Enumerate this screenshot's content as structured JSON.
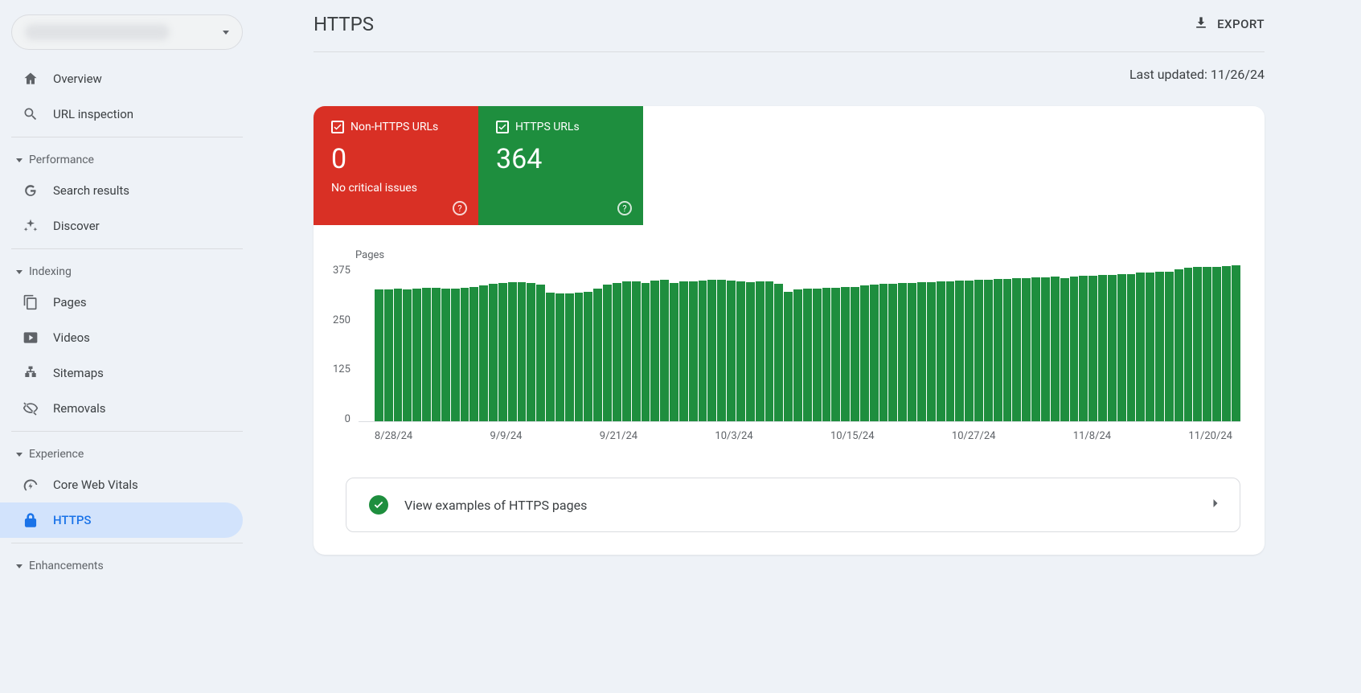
{
  "sidebar": {
    "items": {
      "overview": "Overview",
      "url_inspection": "URL inspection",
      "search_results": "Search results",
      "discover": "Discover",
      "pages": "Pages",
      "videos": "Videos",
      "sitemaps": "Sitemaps",
      "removals": "Removals",
      "cwv": "Core Web Vitals",
      "https": "HTTPS"
    },
    "sections": {
      "performance": "Performance",
      "indexing": "Indexing",
      "experience": "Experience",
      "enhancements": "Enhancements"
    }
  },
  "header": {
    "title": "HTTPS",
    "export_label": "EXPORT",
    "updated_label": "Last updated: ",
    "updated_value": "11/26/24"
  },
  "tiles": {
    "non_https": {
      "label": "Non-HTTPS URLs",
      "value": "0",
      "sub": "No critical issues"
    },
    "https": {
      "label": "HTTPS URLs",
      "value": "364"
    }
  },
  "link_row": {
    "text": "View examples of HTTPS pages"
  },
  "chart_data": {
    "type": "bar",
    "title": "",
    "ylabel": "Pages",
    "xlabel": "",
    "ylim": [
      0,
      375
    ],
    "y_ticks": [
      375,
      250,
      125,
      0
    ],
    "x_ticks": [
      "8/28/24",
      "9/9/24",
      "9/21/24",
      "10/3/24",
      "10/15/24",
      "10/27/24",
      "11/8/24",
      "11/20/24"
    ],
    "categories": [
      "8/28",
      "8/29",
      "8/30",
      "8/31",
      "9/1",
      "9/2",
      "9/3",
      "9/4",
      "9/5",
      "9/6",
      "9/7",
      "9/8",
      "9/9",
      "9/10",
      "9/11",
      "9/12",
      "9/13",
      "9/14",
      "9/15",
      "9/16",
      "9/17",
      "9/18",
      "9/19",
      "9/20",
      "9/21",
      "9/22",
      "9/23",
      "9/24",
      "9/25",
      "9/26",
      "9/27",
      "9/28",
      "9/29",
      "9/30",
      "10/1",
      "10/2",
      "10/3",
      "10/4",
      "10/5",
      "10/6",
      "10/7",
      "10/8",
      "10/9",
      "10/10",
      "10/11",
      "10/12",
      "10/13",
      "10/14",
      "10/15",
      "10/16",
      "10/17",
      "10/18",
      "10/19",
      "10/20",
      "10/21",
      "10/22",
      "10/23",
      "10/24",
      "10/25",
      "10/26",
      "10/27",
      "10/28",
      "10/29",
      "10/30",
      "10/31",
      "11/1",
      "11/2",
      "11/3",
      "11/4",
      "11/5",
      "11/6",
      "11/7",
      "11/8",
      "11/9",
      "11/10",
      "11/11",
      "11/12",
      "11/13",
      "11/14",
      "11/15",
      "11/16",
      "11/17",
      "11/18",
      "11/19",
      "11/20",
      "11/21",
      "11/22",
      "11/23",
      "11/24",
      "11/25",
      "11/26"
    ],
    "values": [
      308,
      308,
      310,
      308,
      310,
      312,
      312,
      310,
      310,
      312,
      314,
      316,
      320,
      322,
      324,
      324,
      322,
      318,
      300,
      298,
      298,
      300,
      302,
      310,
      318,
      322,
      326,
      326,
      322,
      328,
      330,
      322,
      326,
      326,
      328,
      330,
      330,
      328,
      326,
      324,
      326,
      326,
      320,
      302,
      308,
      310,
      310,
      312,
      312,
      314,
      314,
      316,
      318,
      320,
      320,
      322,
      322,
      324,
      324,
      326,
      326,
      328,
      328,
      330,
      330,
      332,
      332,
      334,
      334,
      336,
      336,
      338,
      334,
      338,
      340,
      340,
      342,
      342,
      344,
      344,
      346,
      346,
      348,
      348,
      354,
      358,
      360,
      360,
      360,
      362,
      364
    ]
  }
}
